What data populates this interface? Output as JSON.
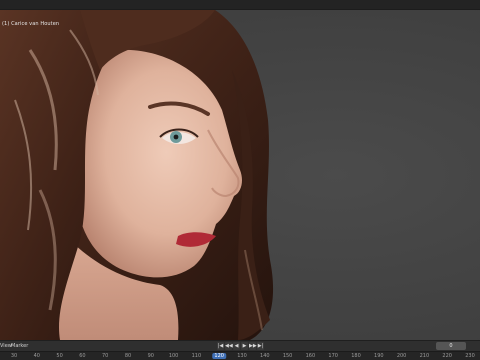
{
  "viewport": {
    "label": "(1) Carice van Houten"
  },
  "timeline": {
    "menu_view": "View",
    "menu_marker": "Marker",
    "playback": [
      "|◀",
      "◀◀",
      "◀",
      "▶",
      "▶▶",
      "▶|"
    ],
    "current_frame": "0"
  },
  "ruler": {
    "ticks": [
      "30",
      "40",
      "50",
      "60",
      "70",
      "80",
      "90",
      "100",
      "110",
      "120",
      "130",
      "140",
      "150",
      "160",
      "170",
      "180",
      "190",
      "200",
      "210",
      "220",
      "230"
    ],
    "current_index": 9
  },
  "colors": {
    "background": "#444444",
    "hair": "#4a2a1c",
    "skin": "#e3b9a4",
    "lips": "#b02a36",
    "eyes": "#6e9a9a",
    "current_frame_highlight": "#3f6fb5"
  }
}
